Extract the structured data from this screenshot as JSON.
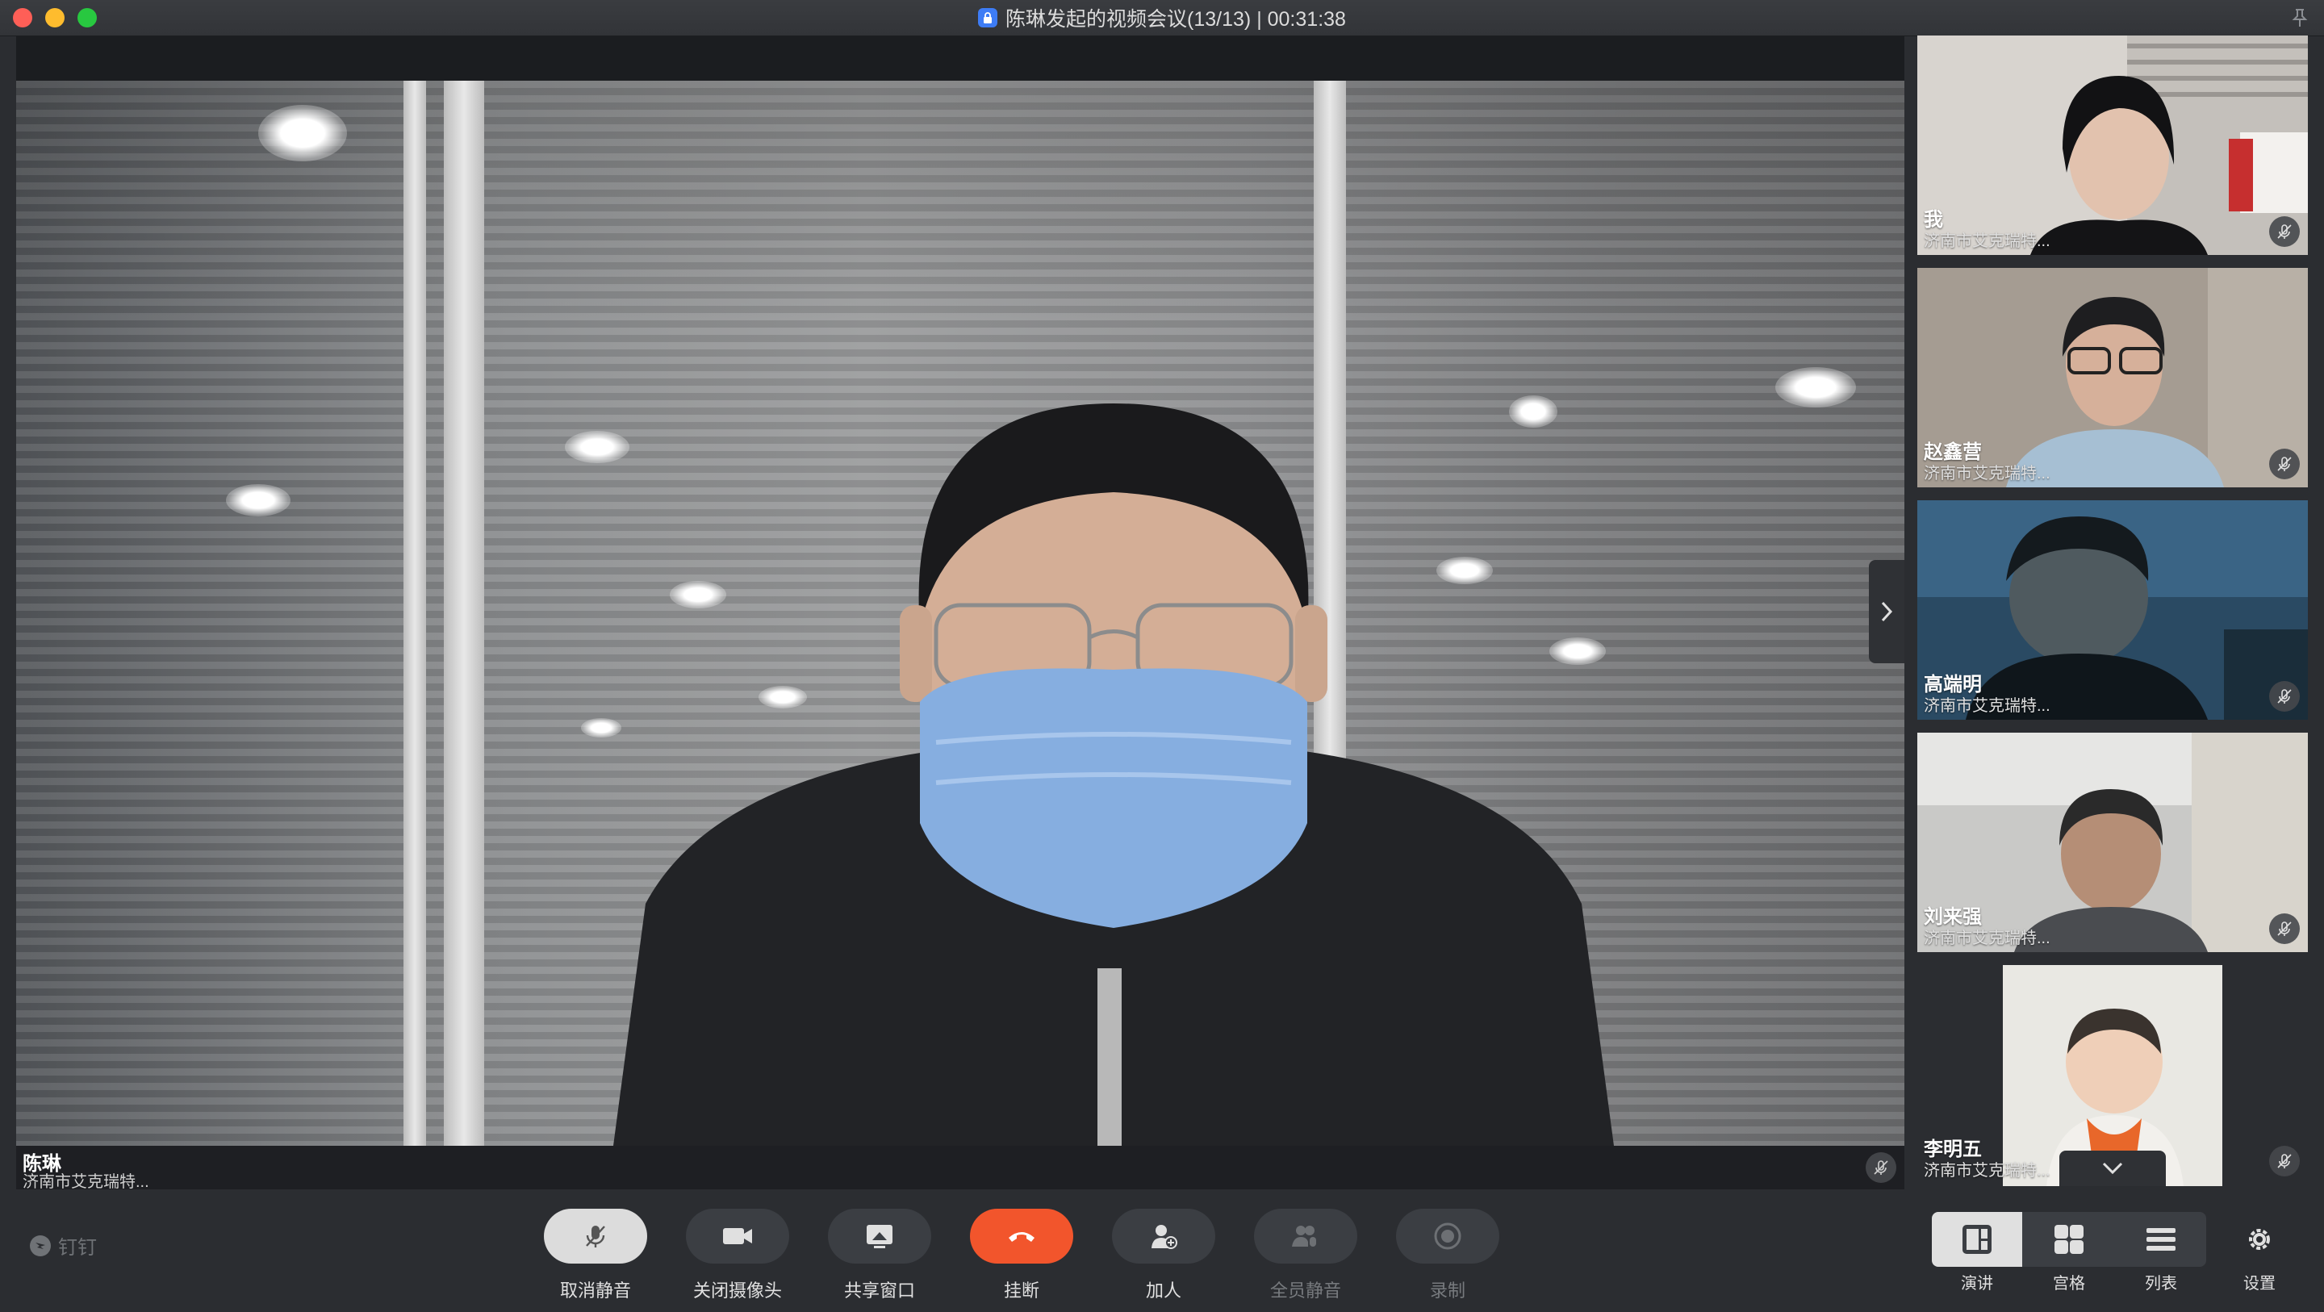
{
  "window": {
    "title": "陈琳发起的视频会议(13/13) | 00:31:38"
  },
  "main_speaker": {
    "name": "陈琳",
    "org": "济南市艾克瑞特..."
  },
  "participants": [
    {
      "name": "我",
      "org": "济南市艾克瑞特..."
    },
    {
      "name": "赵鑫营",
      "org": "济南市艾克瑞特..."
    },
    {
      "name": "高端明",
      "org": "济南市艾克瑞特..."
    },
    {
      "name": "刘来强",
      "org": "济南市艾克瑞特..."
    },
    {
      "name": "李明五",
      "org": "济南市艾克瑞特..."
    }
  ],
  "brand": "钉钉",
  "toolbar": {
    "unmute": "取消静音",
    "camera_off": "关闭摄像头",
    "share_window": "共享窗口",
    "hangup": "挂断",
    "add_person": "加人",
    "mute_all": "全员静音",
    "record": "录制"
  },
  "views": {
    "speaker": "演讲",
    "grid": "宫格",
    "list": "列表",
    "settings": "设置",
    "selected": "演讲"
  },
  "colors": {
    "hangup": "#f2552c",
    "lock": "#3d7cf5",
    "window_bg": "#2b2d31"
  },
  "icons": [
    "lock-icon",
    "pin-icon",
    "mic-muted-icon",
    "camera-icon",
    "share-screen-icon",
    "phone-hangup-icon",
    "add-person-icon",
    "mute-all-icon",
    "record-icon",
    "speaker-view-icon",
    "grid-view-icon",
    "list-view-icon",
    "gear-icon",
    "chevron-right-icon",
    "chevron-down-icon",
    "dingtalk-logo-icon"
  ]
}
